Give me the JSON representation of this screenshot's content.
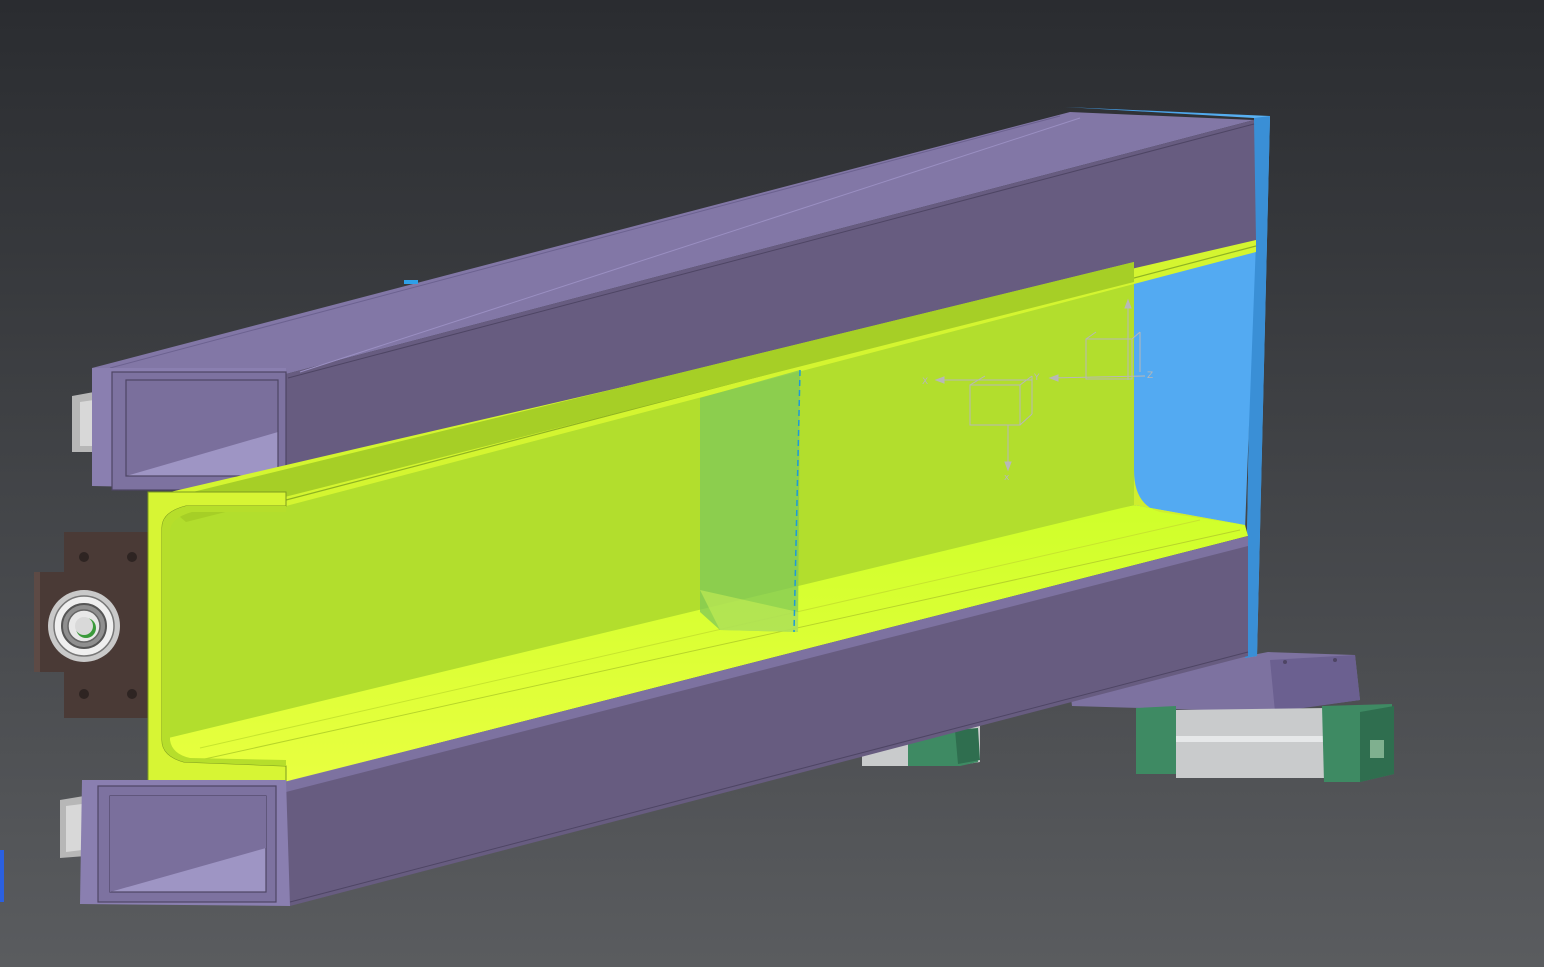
{
  "viewport": {
    "background_top": "#2a2c30",
    "background_bottom": "#5a5c5f"
  },
  "colors": {
    "tube_top": "#8277a6",
    "tube_side": "#675c80",
    "tube_dark": "#4e4564",
    "tube_inner": "#7d72a0",
    "channel_main": "#b2de2d",
    "channel_bright": "#e6ff38",
    "channel_shadow": "#8fb322",
    "end_plate": "#4fa8f0",
    "section_plane": "#7fc85a",
    "section_line": "#1e9bd7",
    "rail_green": "#3e8a63",
    "rail_grey": "#c8cbcc",
    "bearing_dark": "#4a3a36",
    "axis_grey": "#b8b8b8"
  },
  "triad": {
    "axes": [
      {
        "id": "axis-x",
        "label": "X"
      },
      {
        "id": "axis-y",
        "label": "Y"
      },
      {
        "id": "axis-z",
        "label": "Z"
      }
    ],
    "main_label": "x"
  }
}
